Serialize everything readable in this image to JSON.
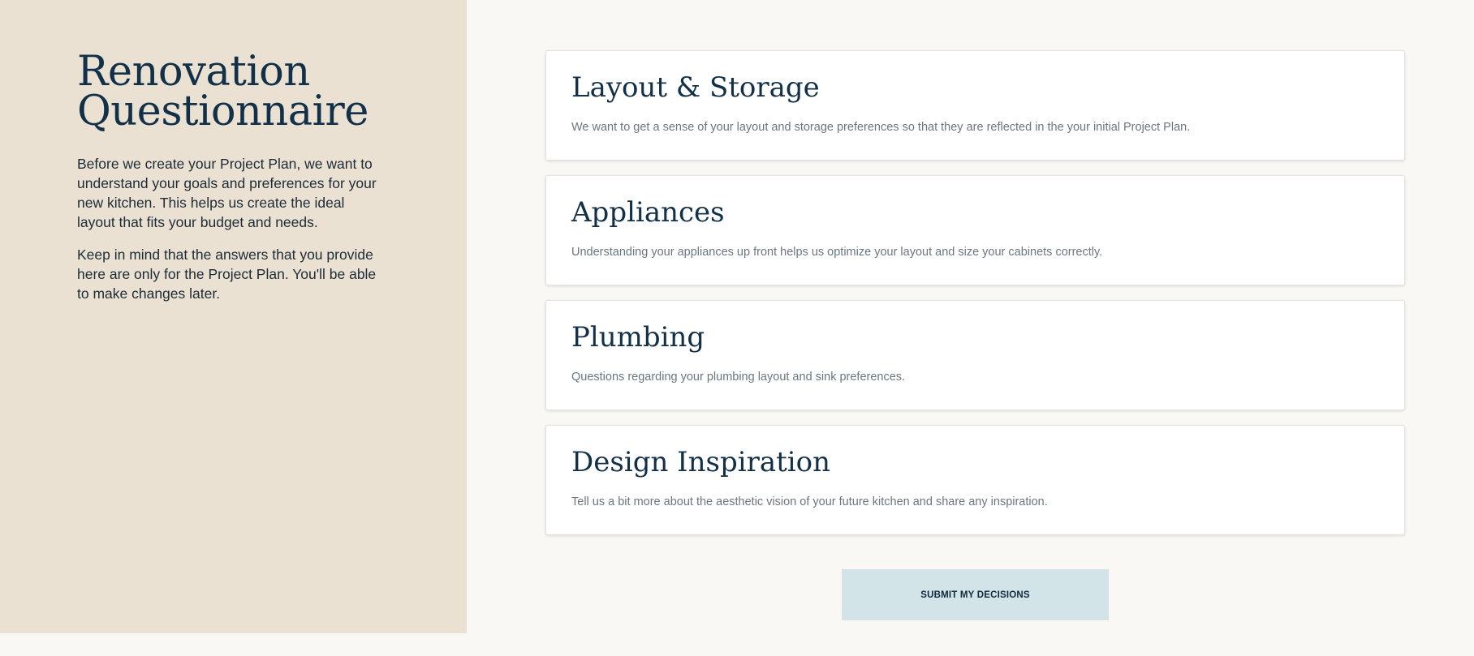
{
  "sidebar": {
    "title": "Renovation Questionnaire",
    "intro_paragraphs": [
      "Before we create your Project Plan, we want to understand your goals and preferences for your new kitchen. This helps us create the ideal layout that fits your budget and needs.",
      "Keep in mind that the answers that you provide here are only for the Project Plan. You'll be able to make changes later."
    ]
  },
  "sections": [
    {
      "title": "Layout & Storage",
      "description": "We want to get a sense of your layout and storage preferences so that they are reflected in the your initial Project Plan."
    },
    {
      "title": "Appliances",
      "description": "Understanding your appliances up front helps us optimize your layout and size your cabinets correctly."
    },
    {
      "title": "Plumbing",
      "description": "Questions regarding your plumbing layout and sink preferences."
    },
    {
      "title": "Design Inspiration",
      "description": "Tell us a bit more about the aesthetic vision of your future kitchen and share any inspiration."
    }
  ],
  "submit": {
    "label": "SUBMIT MY DECISIONS"
  },
  "colors": {
    "sidebar_background": "#ebe1d3",
    "page_background": "#faf8f4",
    "heading_text": "#123047",
    "description_text": "#6b7680",
    "button_background": "#d3e4e8",
    "button_text": "#0f2a3d"
  }
}
